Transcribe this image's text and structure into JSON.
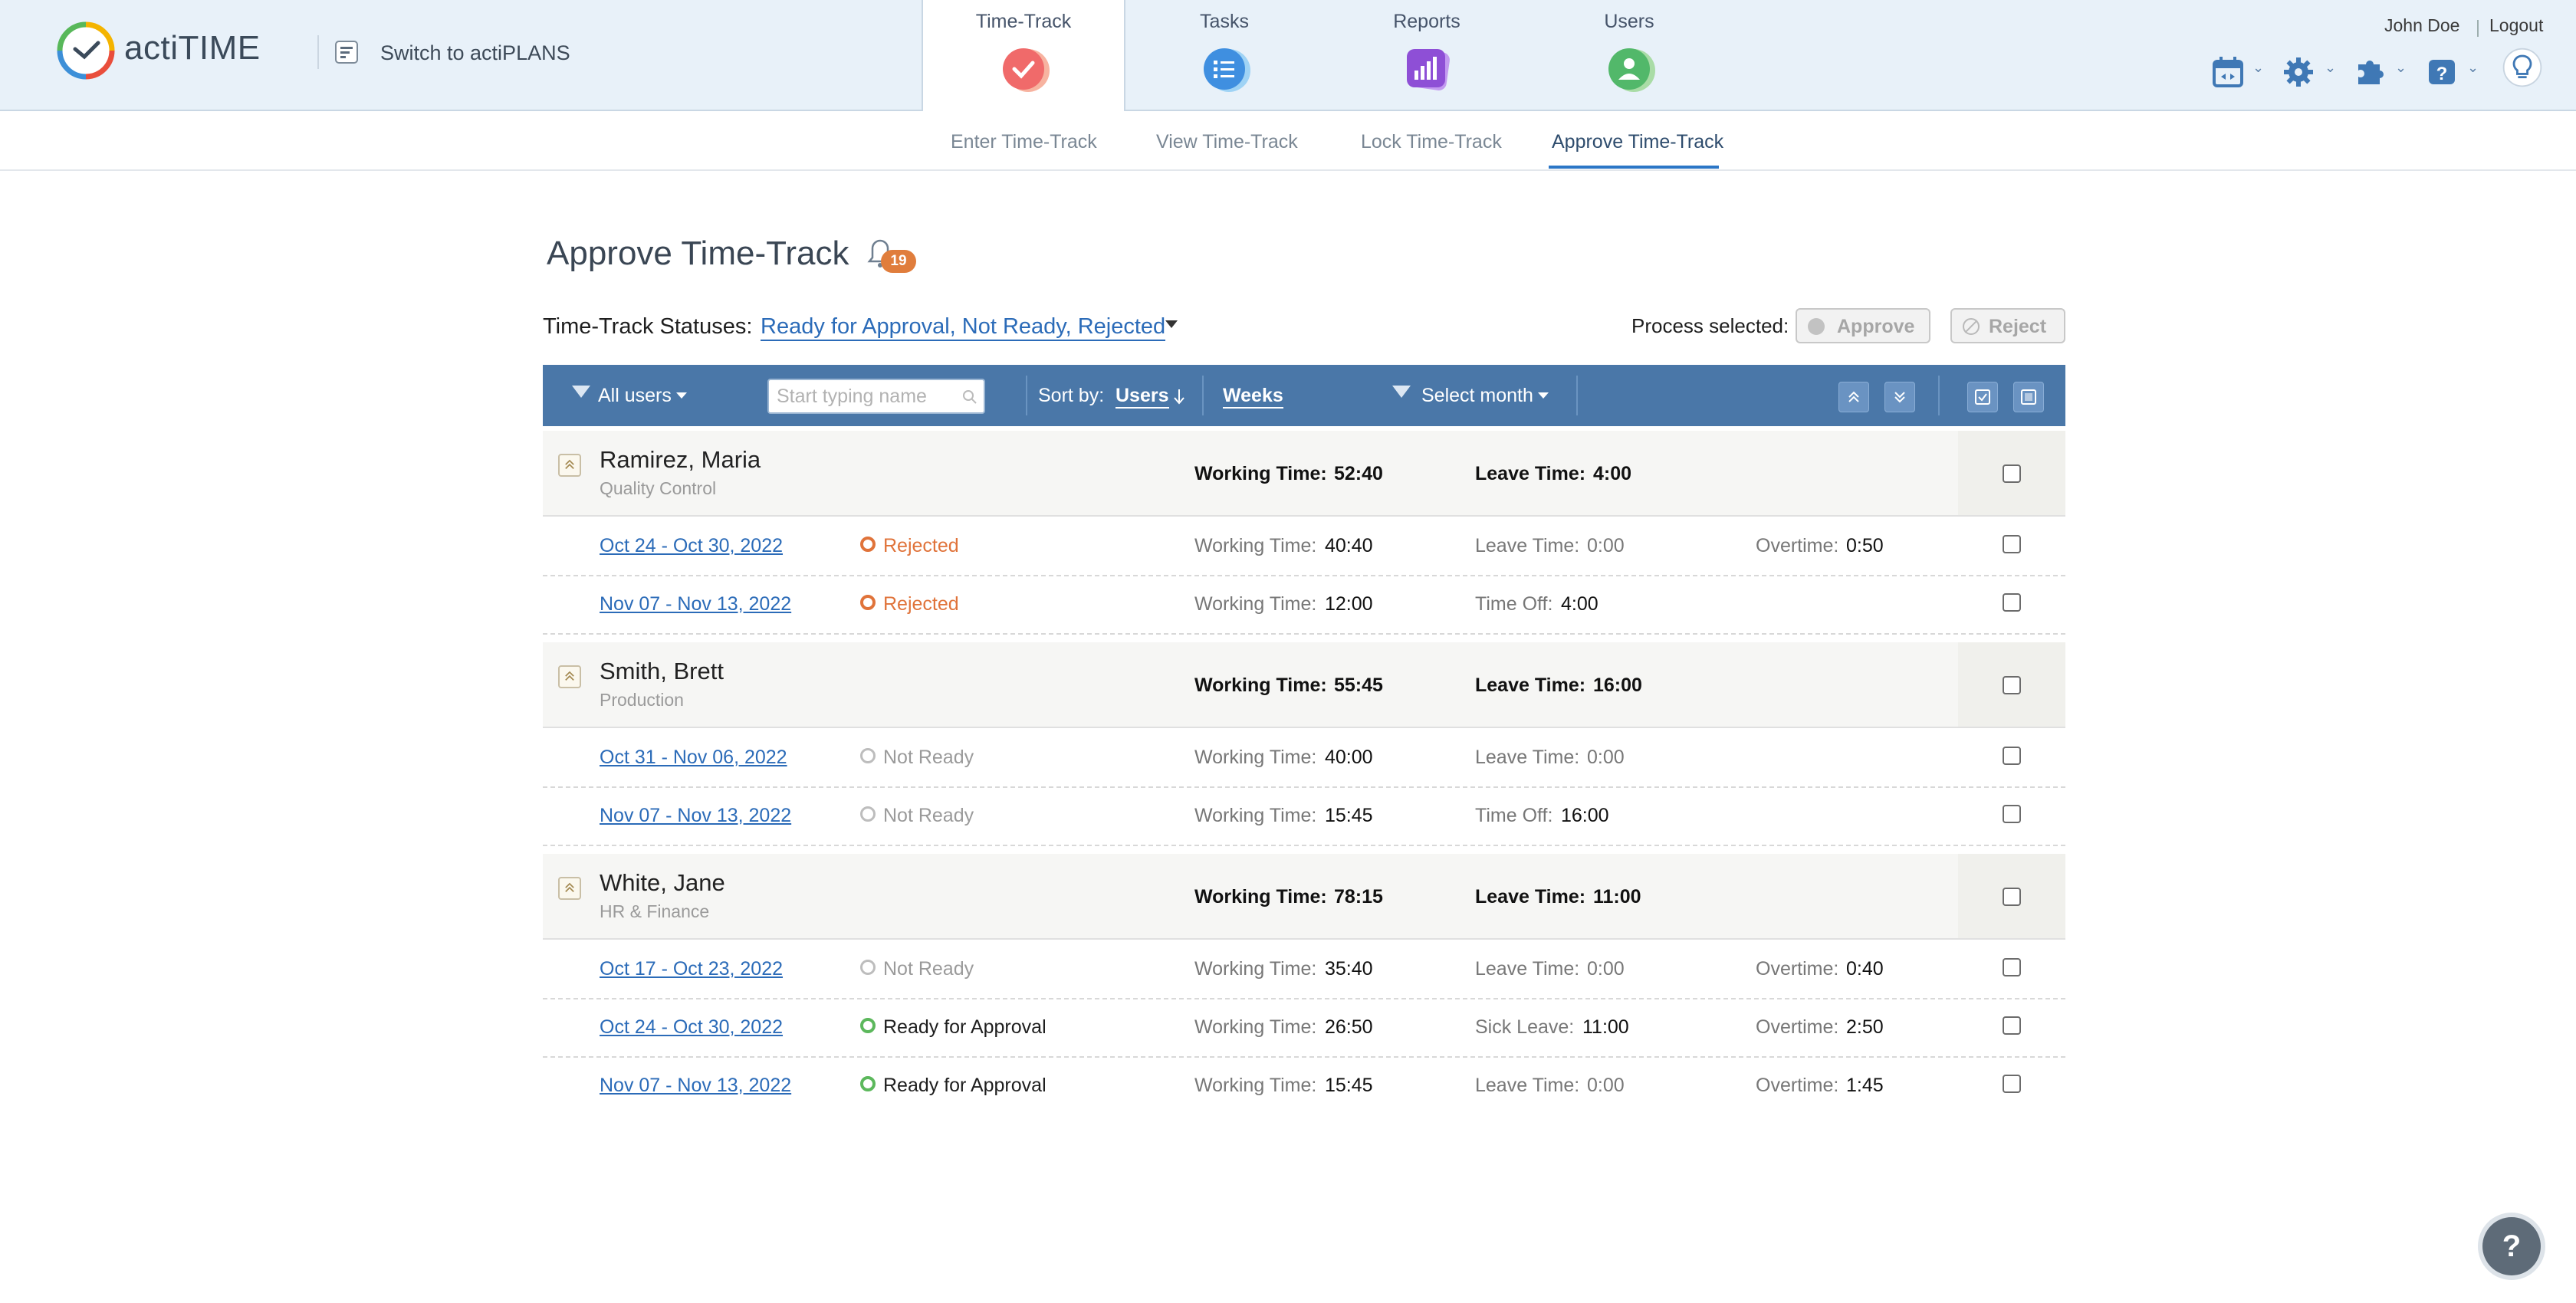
{
  "header": {
    "app_name": "actiTIME",
    "switch_label": "Switch to actiPLANS",
    "tabs": [
      {
        "label": "Time-Track",
        "icon": "check-icon",
        "color": "#f06a6a"
      },
      {
        "label": "Tasks",
        "icon": "list-icon",
        "color": "#3f8fe0"
      },
      {
        "label": "Reports",
        "icon": "chart-icon",
        "color": "#8e4fd6"
      },
      {
        "label": "Users",
        "icon": "user-icon",
        "color": "#52b86a"
      }
    ],
    "user_name": "John Doe",
    "separator": "|",
    "logout": "Logout"
  },
  "subnav": {
    "tabs": [
      "Enter Time-Track",
      "View Time-Track",
      "Lock Time-Track",
      "Approve Time-Track"
    ],
    "active_index": 3
  },
  "page": {
    "title": "Approve Time-Track",
    "notification_count": "19",
    "status_label": "Time-Track Statuses:",
    "status_value": "Ready for Approval, Not Ready, Rejected",
    "process_label": "Process selected:",
    "approve_label": "Approve",
    "reject_label": "Reject"
  },
  "filterbar": {
    "users_filter": "All users",
    "search_placeholder": "Start typing name",
    "sort_label": "Sort by:",
    "sort_users": "Users",
    "sort_weeks": "Weeks",
    "month_filter": "Select month"
  },
  "groups": [
    {
      "name": "Ramirez, Maria",
      "dept": "Quality Control",
      "working_label": "Working Time:",
      "working": "52:40",
      "leave_label": "Leave Time:",
      "leave": "4:00",
      "weeks": [
        {
          "range": "Oct 24 - Oct 30, 2022",
          "status": "Rejected",
          "working_label": "Working Time:",
          "working": "40:40",
          "second_label": "Leave Time:",
          "second": "0:00",
          "ot_label": "Overtime:",
          "overtime": "0:50"
        },
        {
          "range": "Nov 07 - Nov 13, 2022",
          "status": "Rejected",
          "working_label": "Working Time:",
          "working": "12:00",
          "second_label": "Time Off:",
          "second": "4:00",
          "ot_label": "",
          "overtime": ""
        }
      ]
    },
    {
      "name": "Smith, Brett",
      "dept": "Production",
      "working_label": "Working Time:",
      "working": "55:45",
      "leave_label": "Leave Time:",
      "leave": "16:00",
      "weeks": [
        {
          "range": "Oct 31 - Nov 06, 2022",
          "status": "Not Ready",
          "working_label": "Working Time:",
          "working": "40:00",
          "second_label": "Leave Time:",
          "second": "0:00",
          "ot_label": "",
          "overtime": ""
        },
        {
          "range": "Nov 07 - Nov 13, 2022",
          "status": "Not Ready",
          "working_label": "Working Time:",
          "working": "15:45",
          "second_label": "Time Off:",
          "second": "16:00",
          "ot_label": "",
          "overtime": ""
        }
      ]
    },
    {
      "name": "White, Jane",
      "dept": "HR & Finance",
      "working_label": "Working Time:",
      "working": "78:15",
      "leave_label": "Leave Time:",
      "leave": "11:00",
      "weeks": [
        {
          "range": "Oct 17 - Oct 23, 2022",
          "status": "Not Ready",
          "working_label": "Working Time:",
          "working": "35:40",
          "second_label": "Leave Time:",
          "second": "0:00",
          "ot_label": "Overtime:",
          "overtime": "0:40"
        },
        {
          "range": "Oct 24 - Oct 30, 2022",
          "status": "Ready for Approval",
          "working_label": "Working Time:",
          "working": "26:50",
          "second_label": "Sick Leave:",
          "second": "11:00",
          "ot_label": "Overtime:",
          "overtime": "2:50"
        },
        {
          "range": "Nov 07 - Nov 13, 2022",
          "status": "Ready for Approval",
          "working_label": "Working Time:",
          "working": "15:45",
          "second_label": "Leave Time:",
          "second": "0:00",
          "ot_label": "Overtime:",
          "overtime": "1:45"
        }
      ]
    }
  ],
  "status_colors": {
    "Rejected": "#e0733a",
    "Not Ready": "#b5b5b5",
    "Ready for Approval": "#5cb85c"
  },
  "help_fab": "?"
}
